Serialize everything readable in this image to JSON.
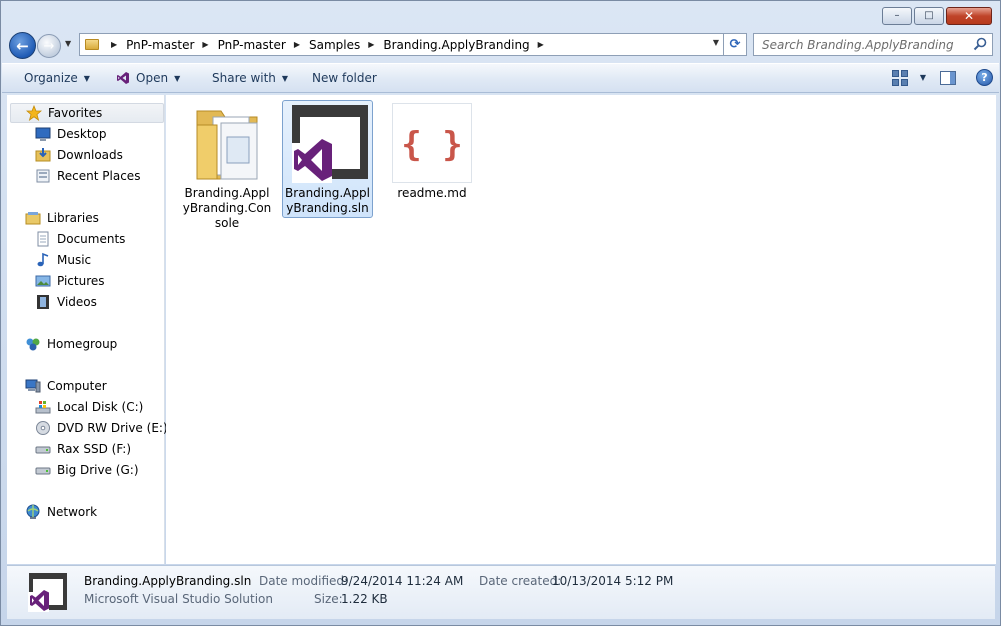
{
  "window": {
    "caption": {
      "minimize": "–",
      "maximize": "□",
      "close": "✕"
    }
  },
  "nav": {
    "back_glyph": "←",
    "forward_glyph": "→",
    "dropdown_glyph": "▼",
    "breadcrumb": [
      {
        "label": "PnP-master"
      },
      {
        "label": "PnP-master"
      },
      {
        "label": "Samples"
      },
      {
        "label": "Branding.ApplyBranding"
      }
    ],
    "crumb_sep": "▶",
    "refresh_glyph": "⟳"
  },
  "search": {
    "placeholder": "Search Branding.ApplyBranding",
    "value": ""
  },
  "toolbar": {
    "organize": "Organize",
    "open": "Open",
    "share_with": "Share with",
    "new_folder": "New folder",
    "caret": "▼",
    "help": "?"
  },
  "sidebar": {
    "favorites": {
      "label": "Favorites",
      "items": [
        {
          "label": "Desktop"
        },
        {
          "label": "Downloads"
        },
        {
          "label": "Recent Places"
        }
      ]
    },
    "libraries": {
      "label": "Libraries",
      "items": [
        {
          "label": "Documents"
        },
        {
          "label": "Music"
        },
        {
          "label": "Pictures"
        },
        {
          "label": "Videos"
        }
      ]
    },
    "homegroup": {
      "label": "Homegroup"
    },
    "computer": {
      "label": "Computer",
      "items": [
        {
          "label": "Local Disk (C:)"
        },
        {
          "label": "DVD RW Drive (E:)"
        },
        {
          "label": "Rax SSD (F:)"
        },
        {
          "label": "Big Drive (G:)"
        }
      ]
    },
    "network": {
      "label": "Network"
    }
  },
  "files": [
    {
      "label": "Branding.ApplyBranding.Console",
      "type": "folder"
    },
    {
      "label": "Branding.ApplyBranding.sln",
      "type": "vs-solution",
      "selected": true
    },
    {
      "label": "readme.md",
      "type": "markdown"
    }
  ],
  "details": {
    "name": "Branding.ApplyBranding.sln",
    "type": "Microsoft Visual Studio Solution",
    "date_modified_label": "Date modified:",
    "date_modified": "9/24/2014 11:24 AM",
    "date_created_label": "Date created:",
    "date_created": "10/13/2014 5:12 PM",
    "size_label": "Size:",
    "size": "1.22 KB"
  },
  "colors": {
    "vs_purple": "#68217a",
    "selection": "#cfe4fb",
    "readme_red": "#c0392b"
  }
}
